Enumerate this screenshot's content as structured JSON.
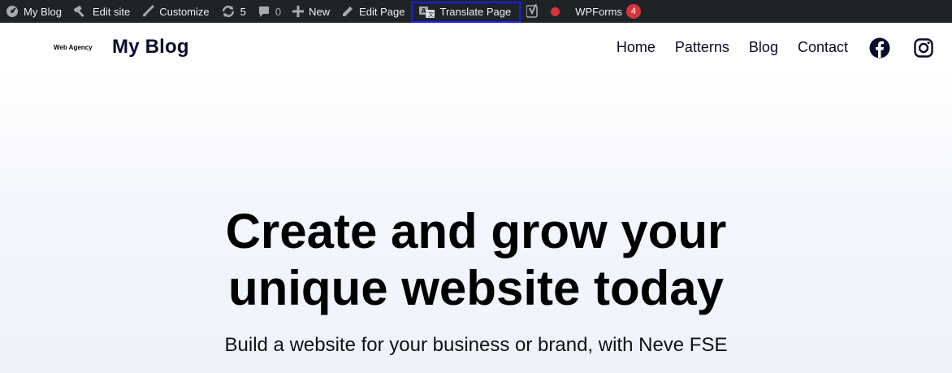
{
  "adminbar": {
    "site_name": "My Blog",
    "edit_site": "Edit site",
    "customize": "Customize",
    "updates_count": "5",
    "comments_count": "0",
    "new": "New",
    "edit_page": "Edit Page",
    "translate_page": "Translate Page",
    "wpforms": "WPForms",
    "wpforms_badge": "4"
  },
  "header": {
    "logo_text": "Web Agency",
    "site_title": "My Blog",
    "nav": [
      "Home",
      "Patterns",
      "Blog",
      "Contact"
    ],
    "social_icons": [
      "facebook-icon",
      "instagram-icon"
    ]
  },
  "hero": {
    "title_line1": "Create and grow your",
    "title_line2": "unique website today",
    "subtitle": "Build a website for your business or brand, with Neve FSE"
  },
  "colors": {
    "adminbar_bg": "#1d2327",
    "highlight_border": "#1a1aff",
    "badge_red": "#d63638"
  }
}
